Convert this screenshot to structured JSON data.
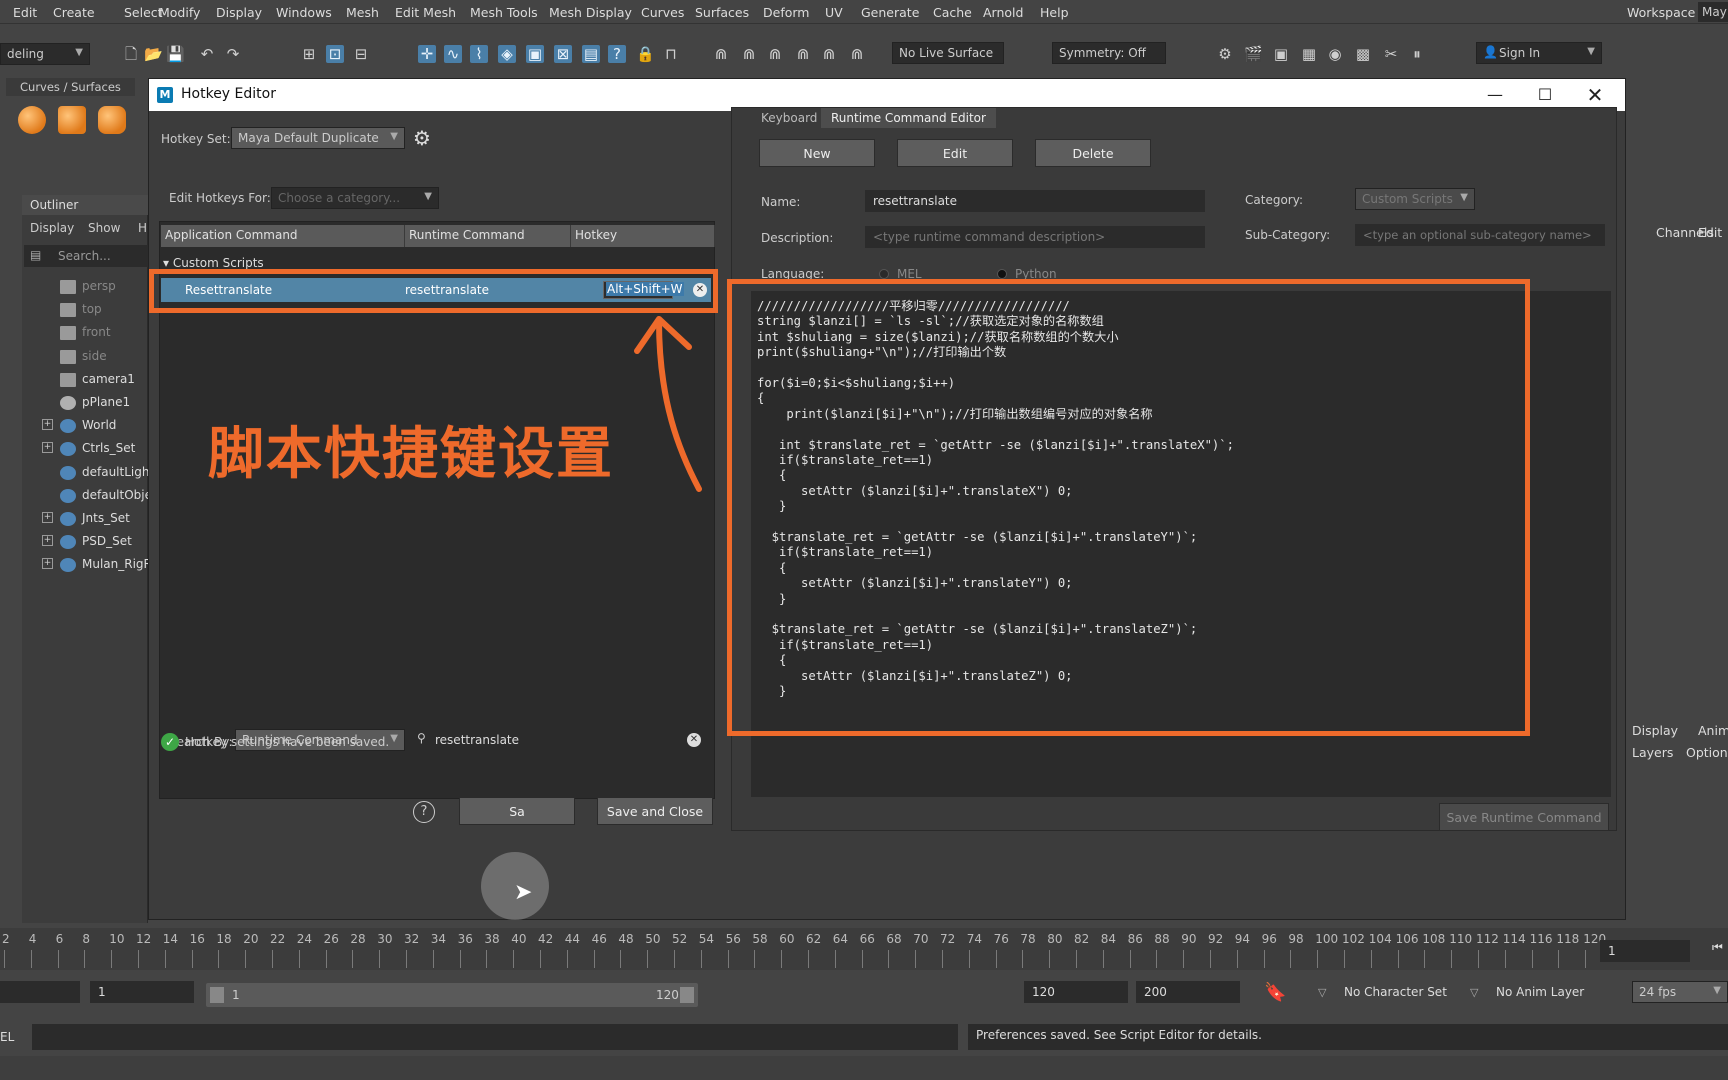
{
  "menubar": {
    "items": [
      "Edit",
      "Create",
      "Select",
      "Modify",
      "Display",
      "Windows",
      "Mesh",
      "Edit Mesh",
      "Mesh Tools",
      "Mesh Display",
      "Curves",
      "Surfaces",
      "Deform",
      "UV",
      "Generate",
      "Cache",
      "Arnold",
      "Help"
    ],
    "workspace_label": "Workspace :",
    "workspace_value": "May"
  },
  "toolbar": {
    "mode": "deling",
    "live_surface": "No Live Surface",
    "symmetry": "Symmetry: Off",
    "sign_in": "Sign In"
  },
  "shelf": {
    "tab": "Curves / Surfaces"
  },
  "outliner": {
    "title": "Outliner",
    "menu": [
      "Display",
      "Show",
      "H"
    ],
    "search_placeholder": "Search...",
    "items": [
      {
        "label": "persp"
      },
      {
        "label": "top"
      },
      {
        "label": "front"
      },
      {
        "label": "side"
      },
      {
        "label": "camera1"
      },
      {
        "label": "pPlane1"
      },
      {
        "label": "World"
      },
      {
        "label": "Ctrls_Set"
      },
      {
        "label": "defaultLightSet"
      },
      {
        "label": "defaultObjectSet"
      },
      {
        "label": "Jnts_Set"
      },
      {
        "label": "PSD_Set"
      },
      {
        "label": "Mulan_RigR"
      }
    ]
  },
  "hotkey_editor": {
    "title": "Hotkey Editor",
    "hotkey_set_label": "Hotkey Set:",
    "hotkey_set_value": "Maya Default Duplicate",
    "edit_for_label": "Edit Hotkeys For:",
    "edit_for_placeholder": "Choose a category...",
    "columns": [
      "Application Command",
      "Runtime Command",
      "Hotkey"
    ],
    "group": "Custom Scripts",
    "row": {
      "app_command": "Resettranslate",
      "runtime_command": "resettranslate",
      "hotkey": "Alt+Shift+W"
    },
    "annotation": "脚本快捷键设置",
    "search_by_label": "Search By:",
    "search_by_value": "Runtime Command",
    "search_value": "resettranslate",
    "status": "Hotkey settings have been saved.",
    "help": "?",
    "save_label": "Sa",
    "save_close_label": "Save and Close"
  },
  "runtime_editor": {
    "tabs": [
      "Keyboard",
      "Runtime Command Editor"
    ],
    "btn_new": "New",
    "btn_edit": "Edit",
    "btn_delete": "Delete",
    "name_label": "Name:",
    "name_value": "resettranslate",
    "desc_label": "Description:",
    "desc_placeholder": "<type runtime command description>",
    "category_label": "Category:",
    "category_value": "Custom Scripts",
    "subcategory_label": "Sub-Category:",
    "subcategory_placeholder": "<type an optional sub-category name>",
    "language_label": "Language:",
    "lang_mel": "MEL",
    "lang_python": "Python",
    "code_lines": [
      "//////////////////平移归零//////////////////",
      "string $lanzi[] = `ls -sl`;//获取选定对象的名称数组",
      "int $shuliang = size($lanzi);//获取名称数组的个数大小",
      "print($shuliang+\"\\n\");//打印输出个数",
      "",
      "for($i=0;$i<$shuliang;$i++)",
      "{",
      "    print($lanzi[$i]+\"\\n\");//打印输出数组编号对应的对象名称",
      "",
      "   int $translate_ret = `getAttr -se ($lanzi[$i]+\".translateX\")`;",
      "   if($translate_ret==1)",
      "   {",
      "      setAttr ($lanzi[$i]+\".translateX\") 0;",
      "   }",
      "",
      "  $translate_ret = `getAttr -se ($lanzi[$i]+\".translateY\")`;",
      "   if($translate_ret==1)",
      "   {",
      "      setAttr ($lanzi[$i]+\".translateY\") 0;",
      "   }",
      "",
      "  $translate_ret = `getAttr -se ($lanzi[$i]+\".translateZ\")`;",
      "   if($translate_ret==1)",
      "   {",
      "      setAttr ($lanzi[$i]+\".translateZ\") 0;",
      "   }",
      "",
      "",
      "}"
    ],
    "save_runtime_label": "Save Runtime Command"
  },
  "right_panel": {
    "channels": "Channels",
    "edit": "Edit",
    "display": "Display",
    "anim": "Anim",
    "layers": "Layers",
    "options": "Options"
  },
  "timeline": {
    "ticks": [
      "2",
      "4",
      "6",
      "8",
      "10",
      "12",
      "14",
      "16",
      "18",
      "20",
      "22",
      "24",
      "26",
      "28",
      "30",
      "32",
      "34",
      "36",
      "38",
      "40",
      "42",
      "44",
      "46",
      "48",
      "50",
      "52",
      "54",
      "56",
      "58",
      "60",
      "62",
      "64",
      "66",
      "68",
      "70",
      "72",
      "74",
      "76",
      "78",
      "80",
      "82",
      "84",
      "86",
      "88",
      "90",
      "92",
      "94",
      "96",
      "98",
      "100",
      "102",
      "104",
      "106",
      "108",
      "110",
      "112",
      "114",
      "116",
      "118",
      "120"
    ],
    "current_frame": "1"
  },
  "range": {
    "start": "1",
    "inner_start": "1",
    "inner_end": "120",
    "end": "120",
    "max_end": "200",
    "character_set": "No Character Set",
    "anim_layer": "No Anim Layer",
    "fps": "24 fps"
  },
  "cmdline": {
    "lang": "EL",
    "message": "Preferences saved. See Script Editor for details."
  },
  "colors": {
    "accent_orange": "#ee6a2b",
    "selection_blue": "#5285a6",
    "ok_green": "#3ea746"
  }
}
